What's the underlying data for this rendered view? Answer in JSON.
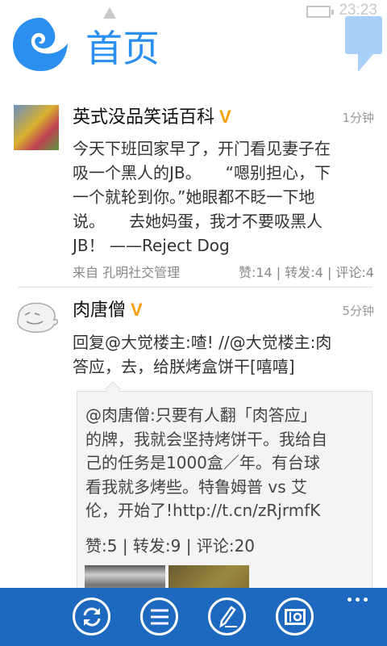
{
  "status": {
    "time": "23:23"
  },
  "header": {
    "title": "首页",
    "accent": "#2b8fef"
  },
  "posts": [
    {
      "author": "英式没品笑话百科",
      "verified": "V",
      "time": "1分钟",
      "lines": [
        "今天下班回家早了，开门看见妻子在",
        "吸一个黑人的JB。　　“嗯别担心，下",
        "一个就轮到你。”她眼都不眨一下地",
        "说。　　去她妈蛋，我才不要吸黑人",
        "JB！ ——Reject Dog"
      ],
      "source": "来自 孔明社交管理",
      "stats": "赞:14 | 转发:4 | 评论:4"
    },
    {
      "author": "肉唐僧",
      "verified": "V",
      "time": "5分钟",
      "lines": [
        "回复@大觉楼主:喳! //@大觉楼主:肉",
        "答应，去，给朕烤盒饼干[嘻嘻]"
      ],
      "quote": {
        "lines": [
          "@肉唐僧:只要有人翻「肉答应」",
          "的牌，我就会坚持烤饼干。我给自",
          "己的任务是1000盒／年。有台球",
          "看我就多烤些。特鲁姆普 vs 艾",
          "伦，开始了!http://t.cn/zRjrmfK"
        ],
        "stats": "赞:5 | 转发:9 | 评论:20"
      }
    }
  ],
  "appbar": {
    "color": "#1e69c0",
    "buttons": [
      "refresh-icon",
      "menu-icon",
      "compose-icon",
      "camera-icon"
    ]
  }
}
